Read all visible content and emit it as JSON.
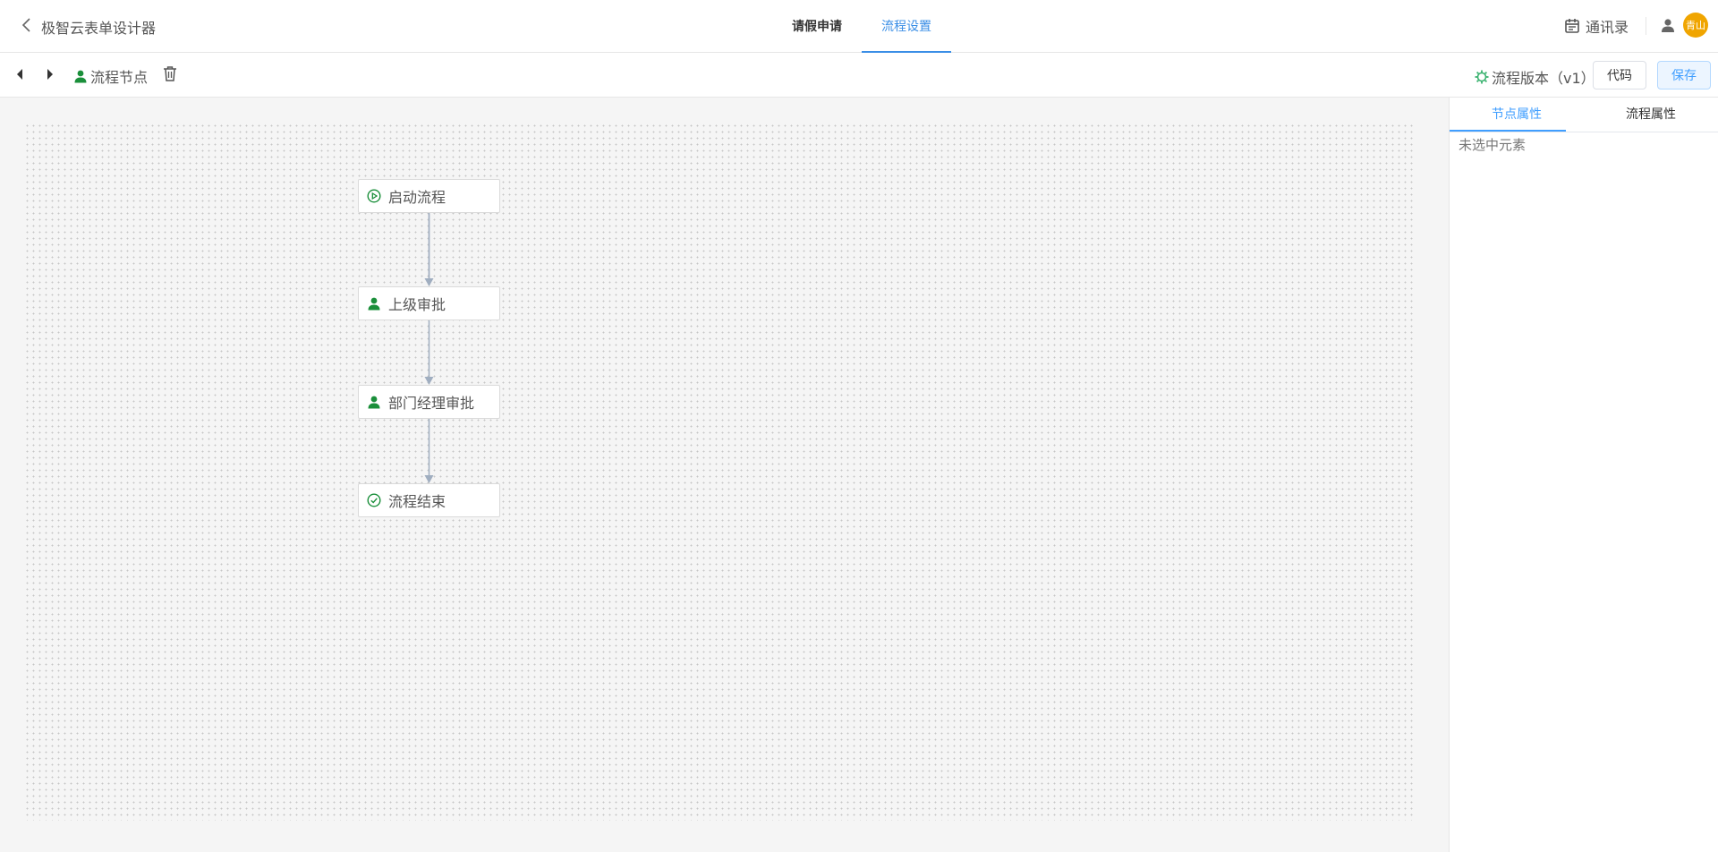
{
  "header": {
    "app_title": "极智云表单设计器",
    "tabs": [
      {
        "label": "请假申请",
        "active": false
      },
      {
        "label": "流程设置",
        "active": true
      }
    ],
    "contacts_label": "通讯录",
    "avatar_text": "青山"
  },
  "toolbar": {
    "node_tool_label": "流程节点",
    "version_label": "流程版本（v1）",
    "code_button": "代码",
    "save_button": "保存"
  },
  "flow": {
    "nodes": [
      {
        "label": "启动流程",
        "icon": "play-circle-icon"
      },
      {
        "label": "上级审批",
        "icon": "user-icon"
      },
      {
        "label": "部门经理审批",
        "icon": "user-icon"
      },
      {
        "label": "流程结束",
        "icon": "check-circle-icon"
      }
    ]
  },
  "panel": {
    "tabs": [
      {
        "label": "节点属性",
        "active": true
      },
      {
        "label": "流程属性",
        "active": false
      }
    ],
    "empty_message": "未选中元素"
  },
  "colors": {
    "accent": "#409eff",
    "node_icon_green": "#1a8f3a",
    "connector": "#a0aec0",
    "avatar": "#f0a500"
  }
}
